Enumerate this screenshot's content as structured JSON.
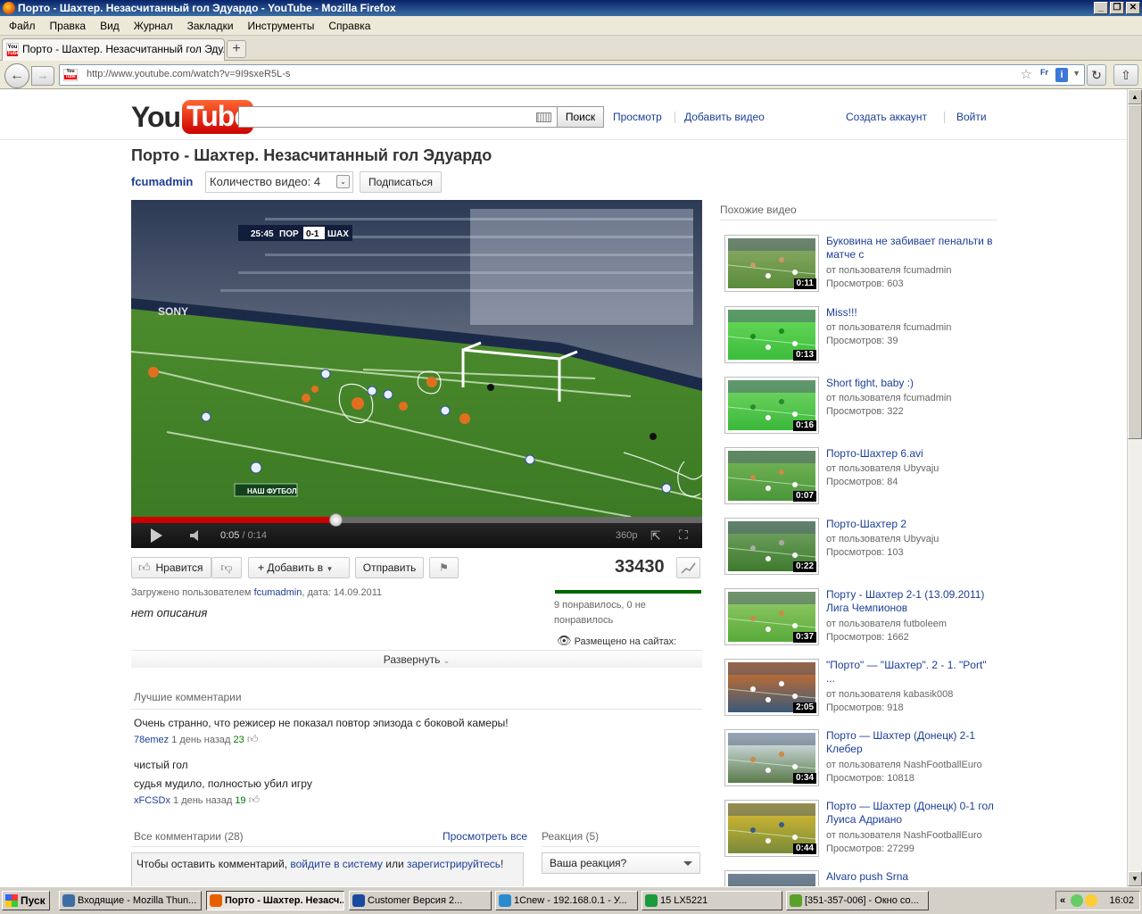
{
  "window": {
    "title": "Порто - Шахтер. Незасчитанный гол Эдуардо - YouTube - Mozilla Firefox",
    "buttons": [
      "_",
      "❐",
      "✕"
    ]
  },
  "menu": [
    "Файл",
    "Правка",
    "Вид",
    "Журнал",
    "Закладки",
    "Инструменты",
    "Справка"
  ],
  "tab": {
    "title": "Порто - Шахтер. Незасчитанный гол Эду...",
    "close": "×",
    "new_tab": "+"
  },
  "nav": {
    "url": "http://www.youtube.com/watch?v=9I9sxeR5L-s",
    "back": "←",
    "forward": "→",
    "reload": "↻",
    "home": "⇧",
    "fr_badge": "Fr"
  },
  "youtube": {
    "logo_you": "You",
    "logo_tube": "Tube",
    "search_placeholder": "",
    "search_button": "Поиск",
    "links": {
      "browse": "Просмотр",
      "upload": "Добавить видео",
      "create_account": "Создать аккаунт",
      "sign_in": "Войти"
    }
  },
  "video": {
    "title": "Порто - Шахтер. Незасчитанный гол Эдуардо",
    "channel": "fcumadmin",
    "video_count": "Количество видео: 4",
    "subscribe": "Подписаться",
    "score_bug": {
      "time": "25:45",
      "home": "ПОР",
      "score": "0-1",
      "away": "ШАХ"
    },
    "sponsor": "SONY",
    "broadcaster": "НАШ ФУТБОЛ",
    "player": {
      "current": "0:05",
      "separator": " / ",
      "duration": "0:14",
      "quality": "360p",
      "progress": 0.36,
      "buffered": 1.0
    },
    "like": "Нравится",
    "add_to": "Добавить в",
    "share": "Отправить",
    "views": "33430",
    "uploaded_prefix": "Загружено пользователем ",
    "uploaded_user": "fcumadmin",
    "uploaded_suffix": ", дата: 14.09.2011",
    "description": "нет описания",
    "likes_text": "9 понравилось, 0 не понравилось",
    "embedded": "Размещено на сайтах:",
    "expand": "Развернуть",
    "like_ratio": 1.0
  },
  "comments": {
    "top_header": "Лучшие комментарии",
    "top": [
      {
        "text": "Очень странно, что режисер не показал повтор эпизода с боковой камеры!",
        "user": "78emez",
        "age": "1 день назад",
        "votes": "23"
      },
      {
        "text": "чистый гол",
        "user": "",
        "age": "",
        "votes": ""
      },
      {
        "text": "судья мудило, полностью убил игру",
        "user": "xFCSDx",
        "age": "1 день назад",
        "votes": "19"
      }
    ],
    "all_header": "Все комментарии (28)",
    "see_all": "Просмотреть все",
    "reaction_header": "Реакция (5)",
    "prompt_before": "Чтобы оставить комментарий, ",
    "prompt_login": "войдите в систему",
    "prompt_or": " или ",
    "prompt_register": "зарегистрируйтесь",
    "prompt_end": "!",
    "reaction_select": "Ваша реакция?"
  },
  "related": {
    "header": "Похожие видео",
    "items": [
      {
        "title": "Буковина не забивает пенальти в матче с",
        "by": "от пользователя fcumadmin",
        "views": "Просмотров: 603",
        "duration": "0:11"
      },
      {
        "title": "Miss!!!",
        "by": "от пользователя fcumadmin",
        "views": "Просмотров: 39",
        "duration": "0:13"
      },
      {
        "title": "Short fight, baby :)",
        "by": "от пользователя fcumadmin",
        "views": "Просмотров: 322",
        "duration": "0:16"
      },
      {
        "title": "Порто-Шахтер 6.avi",
        "by": "от пользователя Ubyvaju",
        "views": "Просмотров: 84",
        "duration": "0:07"
      },
      {
        "title": "Порто-Шахтер 2",
        "by": "от пользователя Ubyvaju",
        "views": "Просмотров: 103",
        "duration": "0:22"
      },
      {
        "title": "Порту - Шахтер 2-1 (13.09.2011) Лига Чемпионов",
        "by": "от пользователя futboleem",
        "views": "Просмотров: 1662",
        "duration": "0:37"
      },
      {
        "title": "\"Порто\" — \"Шахтер\". 2 - 1. \"Port\" ...",
        "by": "от пользователя kabasik008",
        "views": "Просмотров: 918",
        "duration": "2:05"
      },
      {
        "title": "Порто — Шахтер (Донецк) 2-1 Клебер",
        "by": "от пользователя NashFootballEuro",
        "views": "Просмотров: 10818",
        "duration": "0:34"
      },
      {
        "title": "Порто — Шахтер (Донецк) 0-1 гол Луиса Адриано",
        "by": "от пользователя NashFootballEuro",
        "views": "Просмотров: 27299",
        "duration": "0:44"
      },
      {
        "title": "Alvaro push Srna",
        "by": "",
        "views": "",
        "duration": ""
      }
    ]
  },
  "taskbar": {
    "start": "Пуск",
    "tasks": [
      {
        "label": "Входящие - Mozilla Thun...",
        "active": false,
        "color": "#3a6ea5"
      },
      {
        "label": "Порто - Шахтер. Незасч...",
        "active": true,
        "color": "#e66000"
      },
      {
        "label": "Customer       Версия  2...",
        "active": false,
        "color": "#1a4aa0"
      },
      {
        "label": "1Cnew - 192.168.0.1 - У...",
        "active": false,
        "color": "#2a8ad0"
      },
      {
        "label": "15 LX5221",
        "active": false,
        "color": "#1a9a3a"
      },
      {
        "label": "[351-357-006] - Окно со...",
        "active": false,
        "color": "#5aa02a"
      }
    ],
    "tray_chevron": "«",
    "clock": "16:02"
  },
  "colors": {
    "link": "#1c3e96",
    "youtube_red": "#cc0000",
    "pitch": "#3f8a2a"
  }
}
